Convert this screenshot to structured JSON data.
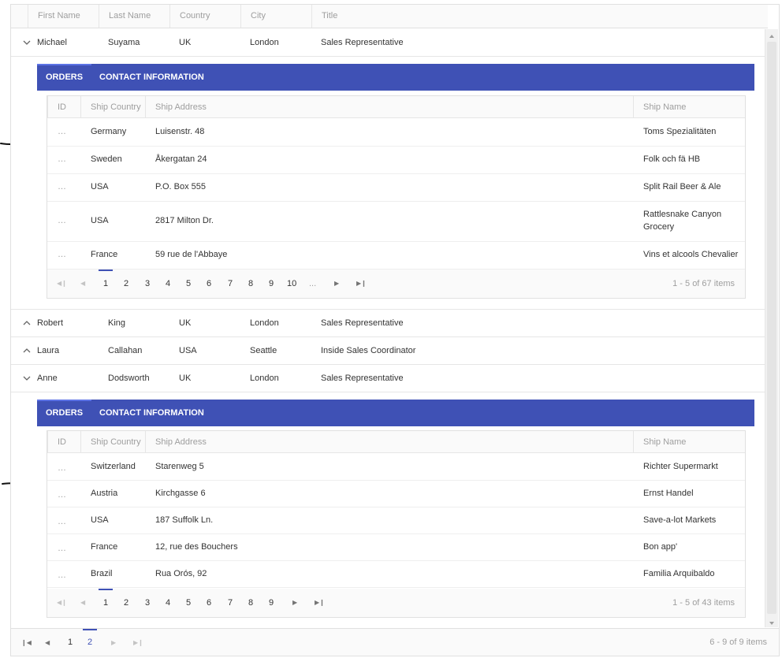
{
  "columns": {
    "first": "First Name",
    "last": "Last Name",
    "country": "Country",
    "city": "City",
    "title": "Title"
  },
  "tabs": {
    "orders": "ORDERS",
    "contact": "CONTACT INFORMATION"
  },
  "child_columns": {
    "id": "ID",
    "ship_country": "Ship Country",
    "ship_address": "Ship Address",
    "ship_name": "Ship Name"
  },
  "ellipsis": "…",
  "employees": [
    {
      "first": "Michael",
      "last": "Suyama",
      "country": "UK",
      "city": "London",
      "title": "Sales Representative",
      "expanded": true
    },
    {
      "first": "Robert",
      "last": "King",
      "country": "UK",
      "city": "London",
      "title": "Sales Representative",
      "expanded": false
    },
    {
      "first": "Laura",
      "last": "Callahan",
      "country": "USA",
      "city": "Seattle",
      "title": "Inside Sales Coordinator",
      "expanded": false
    },
    {
      "first": "Anne",
      "last": "Dodsworth",
      "country": "UK",
      "city": "London",
      "title": "Sales Representative",
      "expanded": true
    }
  ],
  "orders_1": {
    "rows": [
      {
        "country": "Germany",
        "address": "Luisenstr. 48",
        "name": "Toms Spezialitäten"
      },
      {
        "country": "Sweden",
        "address": "Åkergatan 24",
        "name": "Folk och fä HB"
      },
      {
        "country": "USA",
        "address": "P.O. Box 555",
        "name": "Split Rail Beer & Ale"
      },
      {
        "country": "USA",
        "address": "2817 Milton Dr.",
        "name_line1": "Rattlesnake Canyon",
        "name_line2": "Grocery"
      },
      {
        "country": "France",
        "address": "59 rue de l'Abbaye",
        "name": "Vins et alcools Chevalier"
      }
    ],
    "pages": [
      "1",
      "2",
      "3",
      "4",
      "5",
      "6",
      "7",
      "8",
      "9",
      "10",
      "..."
    ],
    "active_page": "1",
    "info": "1 - 5 of 67 items"
  },
  "orders_2": {
    "rows": [
      {
        "country": "Switzerland",
        "address": "Starenweg 5",
        "name": "Richter Supermarkt"
      },
      {
        "country": "Austria",
        "address": "Kirchgasse 6",
        "name": "Ernst Handel"
      },
      {
        "country": "USA",
        "address": "187 Suffolk Ln.",
        "name": "Save-a-lot Markets"
      },
      {
        "country": "France",
        "address": "12, rue des Bouchers",
        "name": "Bon app'"
      },
      {
        "country": "Brazil",
        "address": "Rua Orós, 92",
        "name": "Familia Arquibaldo"
      }
    ],
    "pages": [
      "1",
      "2",
      "3",
      "4",
      "5",
      "6",
      "7",
      "8",
      "9"
    ],
    "active_page": "1",
    "info": "1 - 5 of 43 items"
  },
  "master_pager": {
    "pages": [
      "1",
      "2"
    ],
    "active_page": "2",
    "info": "6 - 9 of 9 items"
  },
  "icons": {
    "first": "first-page-icon",
    "prev": "previous-page-icon",
    "next": "next-page-icon",
    "last": "last-page-icon",
    "expand": "chevron-down-icon",
    "collapse": "chevron-up-icon"
  },
  "colors": {
    "accent": "#3f51b5",
    "header_text": "#9e9e9e",
    "border": "#e0e0e0"
  }
}
